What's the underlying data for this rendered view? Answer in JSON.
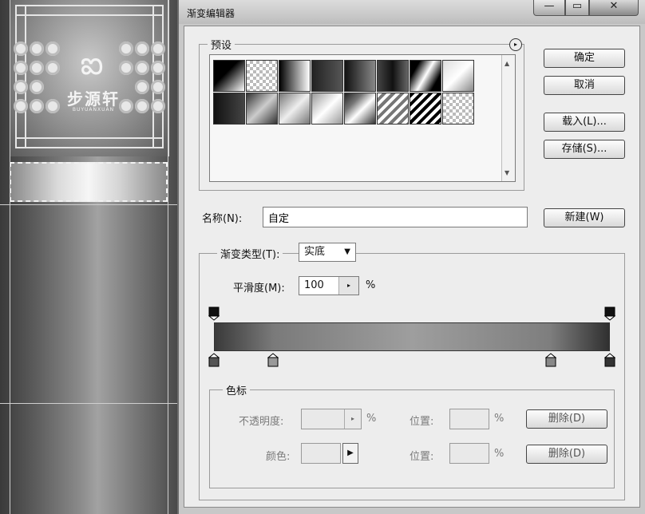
{
  "canvas": {
    "logo_mark": "ఐ",
    "logo_text": "步源轩",
    "logo_sub": "BUYUANXUAN"
  },
  "dialog": {
    "title": "渐变编辑器",
    "window_buttons": {
      "minimize": "—",
      "maximize": "▭",
      "close": "✕"
    },
    "presets_title": "预设",
    "preset_menu_icon": "▸",
    "buttons": {
      "ok": "确定",
      "cancel": "取消",
      "load": "载入(L)...",
      "save": "存储(S)...",
      "new": "新建(W)"
    },
    "name_label": "名称(N):",
    "name_value": "自定",
    "gradient_type_label": "渐变类型(T):",
    "gradient_type_value": "实底",
    "smoothness_label": "平滑度(M):",
    "smoothness_value": "100",
    "smoothness_unit": "%",
    "color_stops": {
      "title": "色标",
      "opacity_label": "不透明度:",
      "opacity_unit": "%",
      "location_label": "位置:",
      "location_unit": "%",
      "delete_label": "删除(D)",
      "color_label": "颜色:",
      "color_arrow": "▶"
    },
    "gradient_stops": {
      "opacity_count": 2,
      "color_locations_percent": [
        0,
        15,
        85,
        100
      ]
    }
  }
}
